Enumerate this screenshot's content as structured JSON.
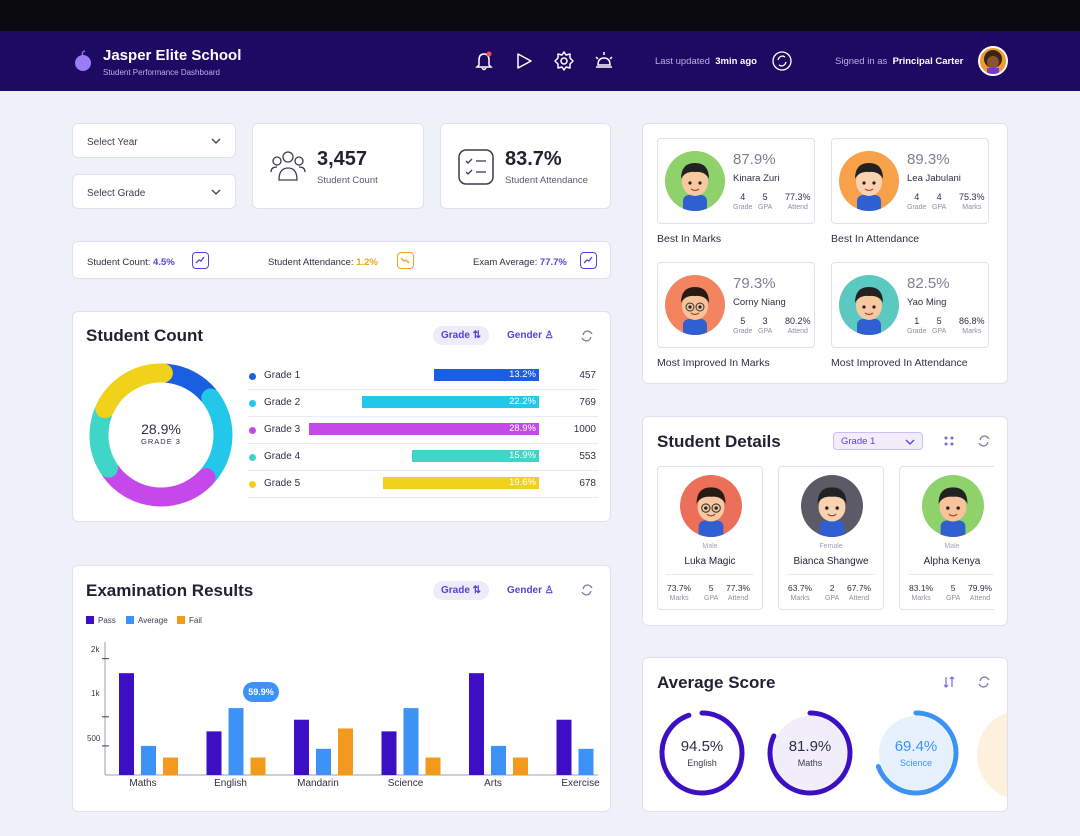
{
  "header": {
    "school_name": "Jasper Elite School",
    "subtitle": "Student Performance Dashboard",
    "last_updated_label": "Last updated",
    "last_updated_value": "3min ago",
    "signed_in_label": "Signed in as",
    "signed_in_user": "Principal Carter",
    "icons": [
      "bell-icon",
      "play-icon",
      "gear-icon",
      "sun-icon",
      "refresh-icon"
    ]
  },
  "filters": {
    "year_placeholder": "Select Year",
    "grade_placeholder": "Select Grade"
  },
  "kpis": {
    "student_count": {
      "value": "3,457",
      "label": "Student Count"
    },
    "attendance": {
      "value": "83.7%",
      "label": "Student Attendance"
    }
  },
  "trends": [
    {
      "label": "Student Count:",
      "value": "4.5%",
      "color": "#5b3fd6"
    },
    {
      "label": "Student Attendance:",
      "value": "1.2%",
      "color": "#f0a21a"
    },
    {
      "label": "Exam Average:",
      "value": "77.7%",
      "color": "#5b3fd6"
    }
  ],
  "student_count_section": {
    "title": "Student Count",
    "grade_label": "Grade",
    "gender_label": "Gender",
    "donut_value": "28.9%",
    "donut_label": "GRADE 3",
    "grades": [
      {
        "name": "Grade 1",
        "pct": "13.2%",
        "count": "457",
        "color": "#1a5fe0",
        "share": 0.132
      },
      {
        "name": "Grade 2",
        "pct": "22.2%",
        "count": "769",
        "color": "#22c7ea",
        "share": 0.222
      },
      {
        "name": "Grade 3",
        "pct": "28.9%",
        "count": "1000",
        "color": "#c549ea",
        "share": 0.289
      },
      {
        "name": "Grade 4",
        "pct": "15.9%",
        "count": "553",
        "color": "#3fd6c8",
        "share": 0.159
      },
      {
        "name": "Grade 5",
        "pct": "19.6%",
        "count": "678",
        "color": "#f0d21a",
        "share": 0.196
      }
    ]
  },
  "exam_section": {
    "title": "Examination Results",
    "grade_label": "Grade",
    "gender_label": "Gender",
    "tooltip": "59.9%",
    "legend": [
      {
        "name": "Pass",
        "color": "#3d0fc4"
      },
      {
        "name": "Average",
        "color": "#3d93f5"
      },
      {
        "name": "Fail",
        "color": "#f39a1c"
      }
    ]
  },
  "chart_data": {
    "type": "bar",
    "categories": [
      "Maths",
      "English",
      "Mandarin",
      "Science",
      "Arts",
      "Exercise"
    ],
    "series": [
      {
        "name": "Pass",
        "values": [
          1750,
          750,
          950,
          750,
          1750,
          950
        ]
      },
      {
        "name": "Average",
        "values": [
          500,
          1150,
          450,
          1150,
          500,
          450
        ]
      },
      {
        "name": "Fail",
        "values": [
          300,
          300,
          800,
          300,
          300,
          0
        ]
      }
    ],
    "yticks": [
      "2k",
      "1k",
      "500"
    ],
    "ylim": [
      0,
      2200
    ]
  },
  "top_students": [
    {
      "pct": "87.9%",
      "name": "Kinara Zuri",
      "s1": "4",
      "s1l": "Grade",
      "s2": "5",
      "s2l": "GPA",
      "s3": "77.3%",
      "s3l": "Attend",
      "caption": "Best In Marks",
      "bg": "#8fd16a"
    },
    {
      "pct": "89.3%",
      "name": "Lea Jabulani",
      "s1": "4",
      "s1l": "Grade",
      "s2": "4",
      "s2l": "GPA",
      "s3": "75.3%",
      "s3l": "Marks",
      "caption": "Best In Attendance",
      "bg": "#f7a24a"
    },
    {
      "pct": "79.3%",
      "name": "Corny Niang",
      "s1": "5",
      "s1l": "Grade",
      "s2": "3",
      "s2l": "GPA",
      "s3": "80.2%",
      "s3l": "Attend",
      "caption": "Most Improved In Marks",
      "bg": "#f2855f"
    },
    {
      "pct": "82.5%",
      "name": "Yao Ming",
      "s1": "1",
      "s1l": "Grade",
      "s2": "5",
      "s2l": "GPA",
      "s3": "86.8%",
      "s3l": "Marks",
      "caption": "Most Improved In Attendance",
      "bg": "#5bc9c0"
    }
  ],
  "student_details": {
    "title": "Student Details",
    "grade_select": "Grade 1",
    "students": [
      {
        "gender": "Male",
        "name": "Luka Magic",
        "a": "73.7%",
        "al": "Marks",
        "b": "5",
        "bl": "GPA",
        "c": "77.3%",
        "cl": "Attend",
        "bg": "#ec6f5a"
      },
      {
        "gender": "Female",
        "name": "Bianca Shangwe",
        "a": "63.7%",
        "al": "Marks",
        "b": "2",
        "bl": "GPA",
        "c": "67.7%",
        "cl": "Attend",
        "bg": "#5c5a66"
      },
      {
        "gender": "Male",
        "name": "Alpha Kenya",
        "a": "83.1%",
        "al": "Marks",
        "b": "5",
        "bl": "GPA",
        "c": "79.9%",
        "cl": "Attend",
        "bg": "#8fd16a"
      }
    ]
  },
  "average_score": {
    "title": "Average Score",
    "gauges": [
      {
        "value": "94.5%",
        "label": "English",
        "color": "#3d0fc4",
        "bg": "#ffffff",
        "level": 0.945
      },
      {
        "value": "81.9%",
        "label": "Maths",
        "color": "#3d0fc4",
        "bg": "#f1edfb",
        "level": 0.819
      },
      {
        "value": "69.4%",
        "label": "Science",
        "color": "#3d93f5",
        "bg": "#e7f1fe",
        "level": 0.694
      }
    ]
  }
}
